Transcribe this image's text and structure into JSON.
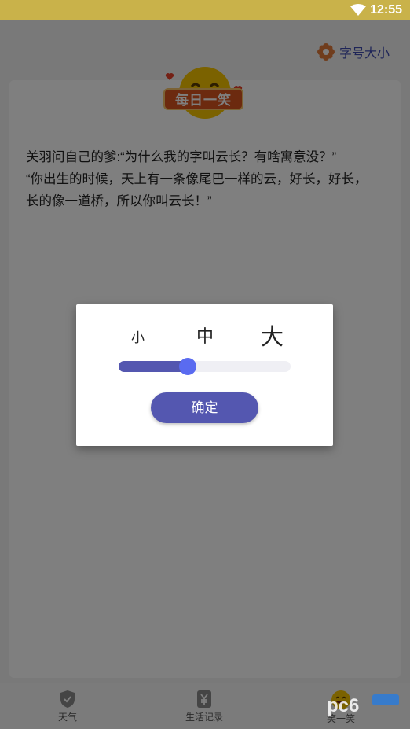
{
  "status_bar": {
    "time": "12:55"
  },
  "header": {
    "font_size_label": "字号大小"
  },
  "banner": {
    "label": "每日一笑"
  },
  "joke": {
    "text": "关羽问自己的爹:“为什么我的字叫云长？有啥寓意没？”\n“你出生的时候，天上有一条像尾巴一样的云，好长，好长，长的像一道桥，所以你叫云长！”"
  },
  "dialog": {
    "size_small": "小",
    "size_medium": "中",
    "size_large": "大",
    "slider_value": 0.4,
    "confirm_label": "确定"
  },
  "bottom_nav": {
    "items": [
      {
        "label": "天气",
        "icon": "shield-icon"
      },
      {
        "label": "生活记录",
        "icon": "yuan-icon"
      },
      {
        "label": "笑一笑",
        "icon": "smile-icon"
      }
    ]
  },
  "colors": {
    "accent": "#5457b0",
    "thumb": "#5a6bf0",
    "status_bar": "#c9b24a",
    "banner": "#d9541e"
  }
}
